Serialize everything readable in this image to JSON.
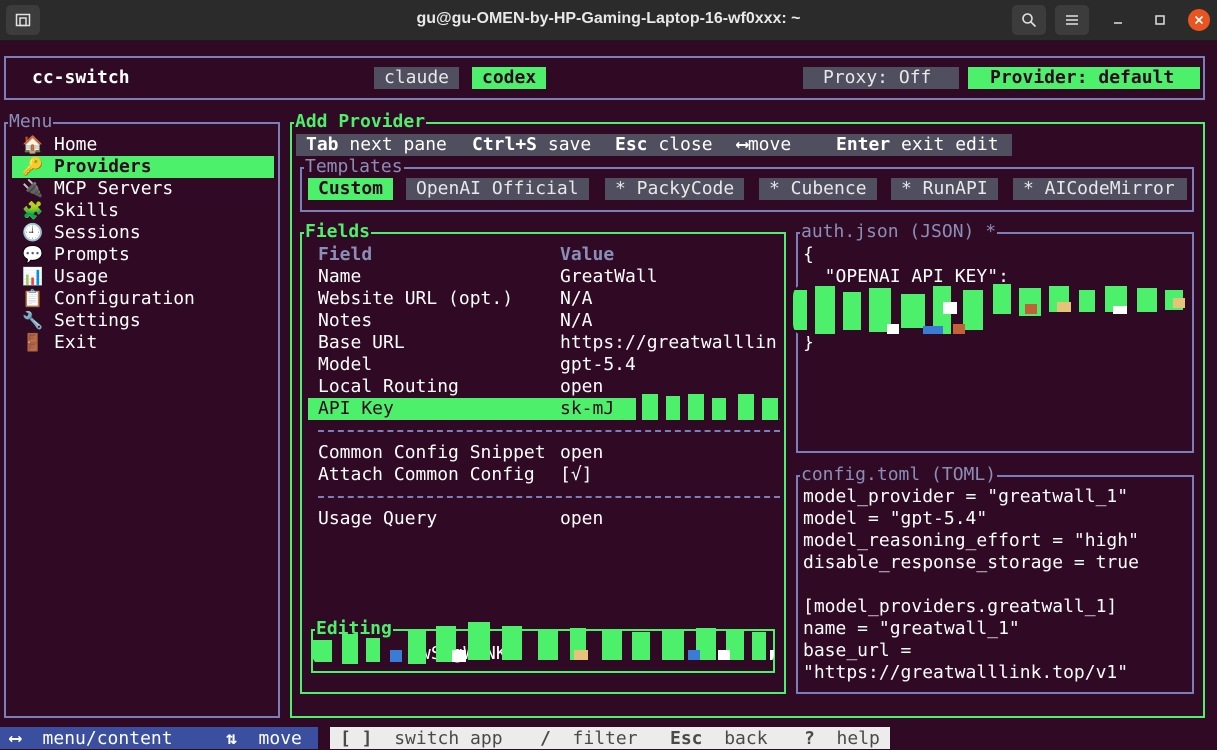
{
  "window": {
    "title": "gu@gu-OMEN-by-HP-Gaming-Laptop-16-wf0xxx: ~"
  },
  "header": {
    "app_name": "cc-switch",
    "tabs": [
      {
        "label": "claude",
        "active": false
      },
      {
        "label": "codex",
        "active": true
      }
    ],
    "proxy": "Proxy: Off",
    "provider": "Provider: default"
  },
  "menu": {
    "title": "Menu",
    "items": [
      {
        "label": "Home",
        "icon": "house-icon",
        "glyph": "🏠"
      },
      {
        "label": "Providers",
        "icon": "key-icon",
        "glyph": "🔑",
        "selected": true
      },
      {
        "label": "MCP Servers",
        "icon": "plug-icon",
        "glyph": "🔌"
      },
      {
        "label": "Skills",
        "icon": "puzzle-icon",
        "glyph": "🧩"
      },
      {
        "label": "Sessions",
        "icon": "clock-icon",
        "glyph": "🕘"
      },
      {
        "label": "Prompts",
        "icon": "speech-bubble-icon",
        "glyph": "💬"
      },
      {
        "label": "Usage",
        "icon": "chart-icon",
        "glyph": "📊"
      },
      {
        "label": "Configuration",
        "icon": "clipboard-icon",
        "glyph": "📋"
      },
      {
        "label": "Settings",
        "icon": "wrench-icon",
        "glyph": "🔧"
      },
      {
        "label": "Exit",
        "icon": "door-icon",
        "glyph": "🚪"
      }
    ]
  },
  "add_provider": {
    "title": "Add Provider",
    "hints": [
      {
        "key": "Tab",
        "action": "next pane"
      },
      {
        "key": "Ctrl+S",
        "action": "save"
      },
      {
        "key": "Esc",
        "action": "close"
      },
      {
        "key": "⟷",
        "action": "move"
      },
      {
        "key": "Enter",
        "action": "exit edit"
      }
    ],
    "templates": {
      "title": "Templates",
      "items": [
        "Custom",
        "OpenAI Official",
        "* PackyCode",
        "* Cubence",
        "* RunAPI",
        "* AICodeMirror"
      ]
    },
    "fields": {
      "title": "Fields",
      "header_field": "Field",
      "header_value": "Value",
      "rows": [
        {
          "field": "Name",
          "value": "GreatWall"
        },
        {
          "field": "Website URL (opt.)",
          "value": "N/A"
        },
        {
          "field": "Notes",
          "value": "N/A"
        },
        {
          "field": "Base URL",
          "value": "https://greatwalllin"
        },
        {
          "field": "Model",
          "value": "gpt-5.4"
        },
        {
          "field": "Local Routing",
          "value": "open"
        },
        {
          "field": "API Key",
          "value": "sk-mJ",
          "selected": true
        }
      ],
      "rows2": [
        {
          "field": "Common Config Snippet",
          "value": "open"
        },
        {
          "field": "Attach Common Config",
          "value": "[√]"
        }
      ],
      "rows3": [
        {
          "field": "Usage Query",
          "value": "open"
        }
      ],
      "editing_title": "Editing",
      "editing_value": "wSogWANKs"
    },
    "auth": {
      "title": "auth.json (JSON) *",
      "lines": [
        "{",
        "  \"OPENAI_API_KEY\":",
        "}"
      ]
    },
    "config": {
      "title": "config.toml (TOML)",
      "lines": [
        "model_provider = \"greatwall_1\"",
        "model = \"gpt-5.4\"",
        "model_reasoning_effort = \"high\"",
        "disable_response_storage = true",
        "",
        "[model_providers.greatwall_1]",
        "name = \"greatwall_1\"",
        "base_url =",
        "\"https://greatwalllink.top/v1\""
      ]
    }
  },
  "footer": {
    "left": [
      {
        "key": "⟷",
        "action": "menu/content"
      },
      {
        "key": "⇅",
        "action": "move"
      }
    ],
    "right": [
      {
        "key": "[ ]",
        "action": "switch app"
      },
      {
        "key": "/",
        "action": "filter"
      },
      {
        "key": "Esc",
        "action": "back"
      },
      {
        "key": "?",
        "action": "help"
      }
    ]
  }
}
